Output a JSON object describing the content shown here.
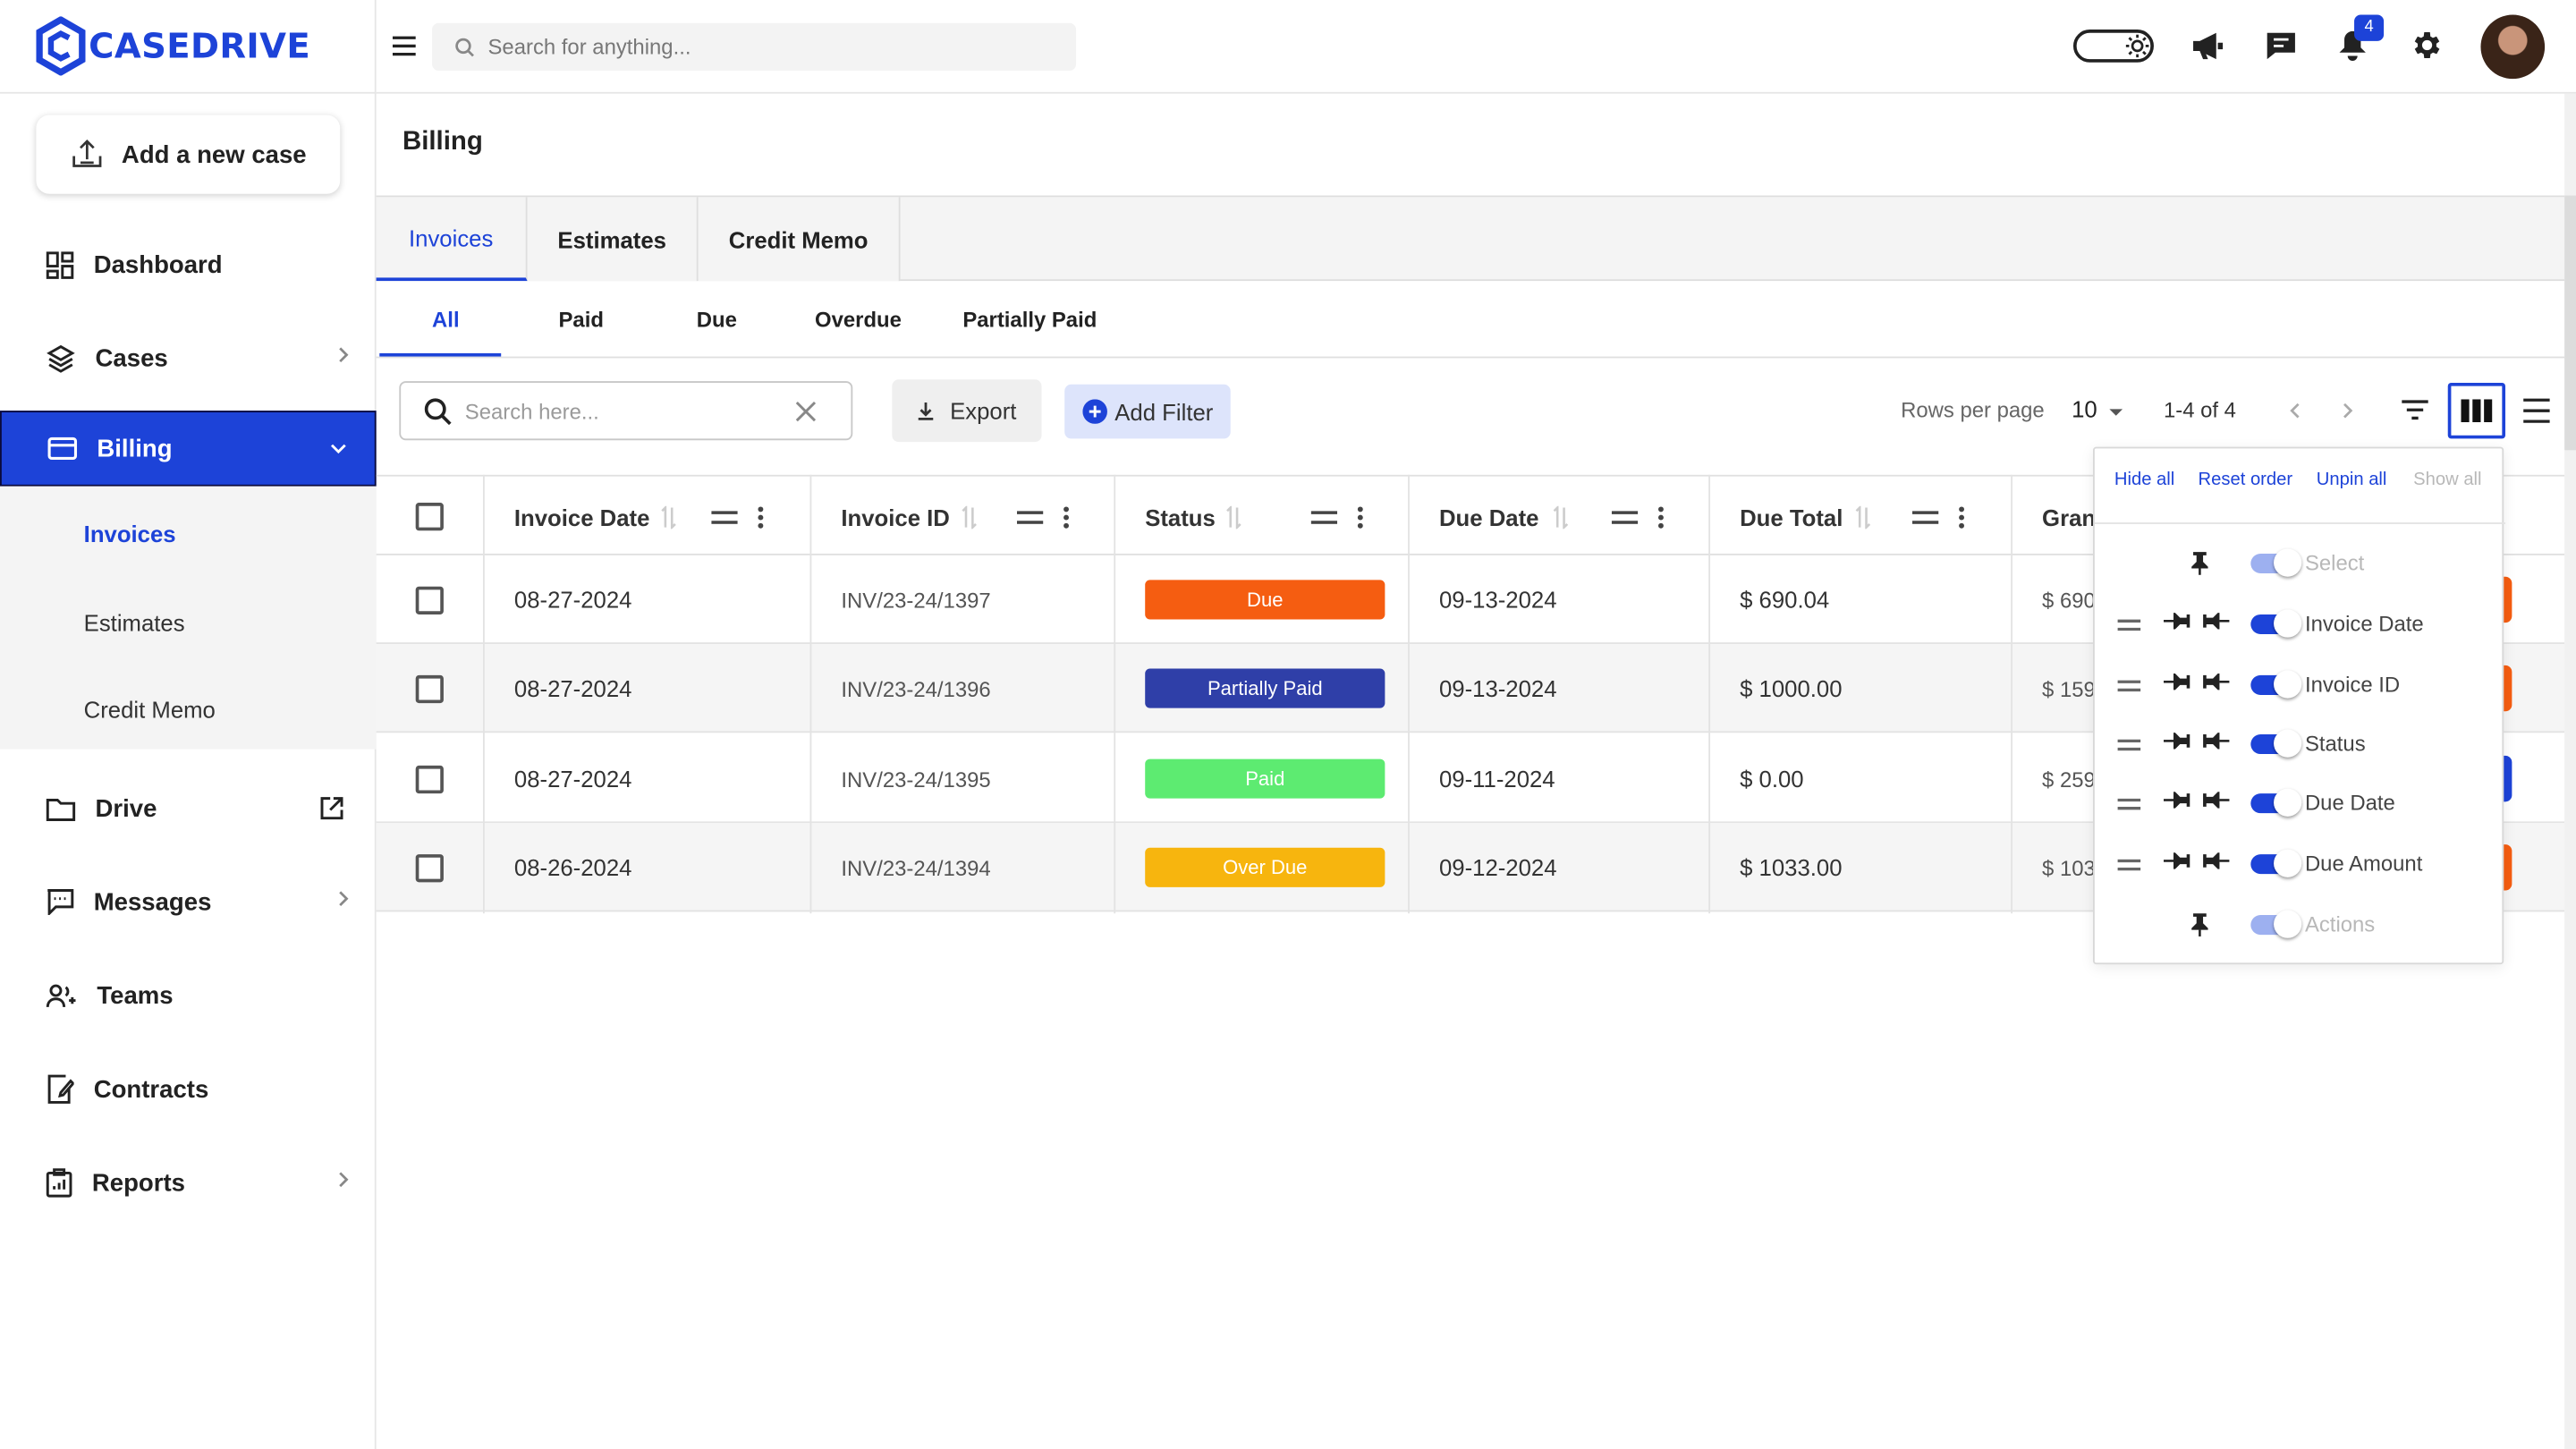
{
  "brand": {
    "name": "CASEDRIVE",
    "color": "#1d43d8"
  },
  "topbar": {
    "search_placeholder": "Search for anything...",
    "notification_count": "4"
  },
  "sidebar": {
    "add_case": "Add a new case",
    "items": [
      {
        "label": "Dashboard",
        "icon": "dashboard-icon"
      },
      {
        "label": "Cases",
        "icon": "layers-icon"
      },
      {
        "label": "Billing",
        "icon": "card-icon"
      },
      {
        "label": "Drive",
        "icon": "folder-icon"
      },
      {
        "label": "Messages",
        "icon": "message-icon"
      },
      {
        "label": "Teams",
        "icon": "team-icon"
      },
      {
        "label": "Contracts",
        "icon": "contract-icon"
      },
      {
        "label": "Reports",
        "icon": "clipboard-icon"
      }
    ],
    "billing_sub": [
      "Invoices",
      "Estimates",
      "Credit Memo"
    ]
  },
  "page": {
    "title": "Billing"
  },
  "tabs": [
    "Invoices",
    "Estimates",
    "Credit Memo"
  ],
  "filter_tabs": [
    "All",
    "Paid",
    "Due",
    "Overdue",
    "Partially Paid"
  ],
  "toolbar": {
    "search_placeholder": "Search here...",
    "export": "Export",
    "add_filter": "Add Filter",
    "rows_per_page_label": "Rows per page",
    "rows_per_page": "10",
    "page_range": "1-4 of 4"
  },
  "table": {
    "columns": [
      "Invoice Date",
      "Invoice ID",
      "Status",
      "Due Date",
      "Due Total",
      "Gran"
    ],
    "rows": [
      {
        "invoice_date": "08-27-2024",
        "invoice_id": "INV/23-24/1397",
        "status": "Due",
        "status_color": "#f55d11",
        "due_date": "09-13-2024",
        "due_total": "$ 690.04",
        "grand": "$ 690"
      },
      {
        "invoice_date": "08-27-2024",
        "invoice_id": "INV/23-24/1396",
        "status": "Partially Paid",
        "status_color": "#2f3fa8",
        "due_date": "09-13-2024",
        "due_total": "$ 1000.00",
        "grand": "$ 159("
      },
      {
        "invoice_date": "08-27-2024",
        "invoice_id": "INV/23-24/1395",
        "status": "Paid",
        "status_color": "#5deb71",
        "due_date": "09-11-2024",
        "due_total": "$ 0.00",
        "grand": "$ 259"
      },
      {
        "invoice_date": "08-26-2024",
        "invoice_id": "INV/23-24/1394",
        "status": "Over Due",
        "status_color": "#f7b50e",
        "due_date": "09-12-2024",
        "due_total": "$ 1033.00",
        "grand": "$ 103:"
      }
    ]
  },
  "column_panel": {
    "links": [
      "Hide all",
      "Reset order",
      "Unpin all",
      "Show all"
    ],
    "items": [
      "Select",
      "Invoice Date",
      "Invoice ID",
      "Status",
      "Due Date",
      "Due Amount",
      "Actions"
    ]
  }
}
